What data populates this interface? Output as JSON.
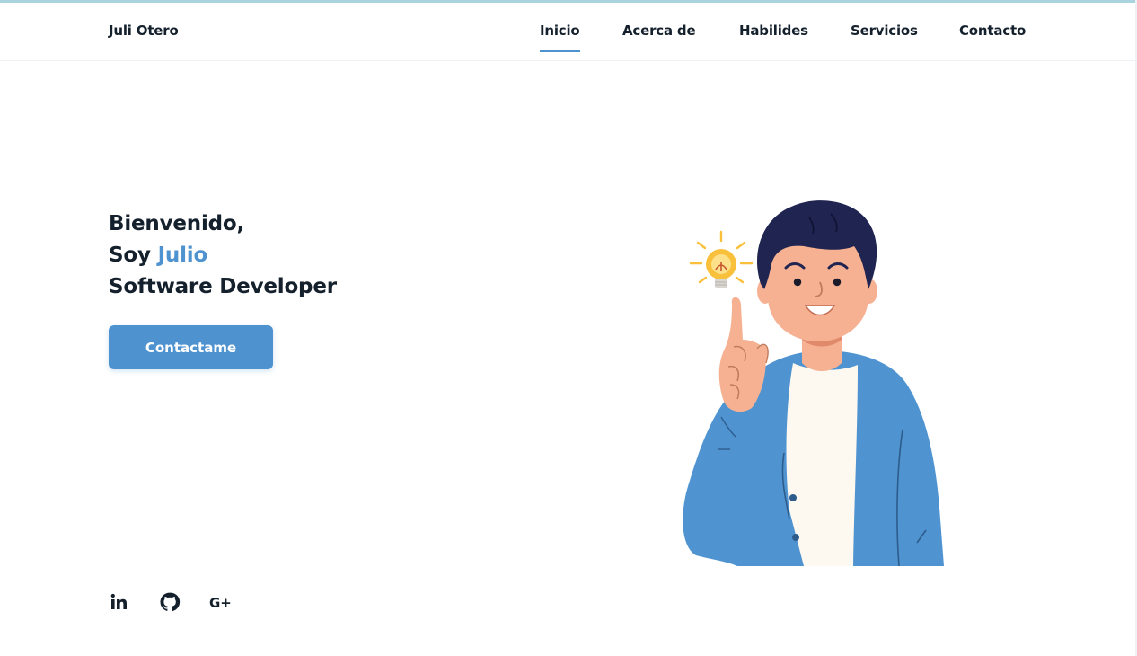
{
  "header": {
    "logo": "Juli Otero",
    "nav": [
      {
        "label": "Inicio",
        "active": true
      },
      {
        "label": "Acerca de",
        "active": false
      },
      {
        "label": "Habilides",
        "active": false
      },
      {
        "label": "Servicios",
        "active": false
      },
      {
        "label": "Contacto",
        "active": false
      }
    ]
  },
  "hero": {
    "greeting": "Bienvenido,",
    "soy": "Soy",
    "name": "Julio",
    "role": "Software Developer",
    "cta_label": "Contactame"
  },
  "social": [
    {
      "icon": "linkedin-icon",
      "text": "in"
    },
    {
      "icon": "github-icon"
    },
    {
      "icon": "google-plus-icon",
      "text": "G+"
    }
  ],
  "colors": {
    "accent": "#4e93cf",
    "text": "#14202c",
    "background": "#ffffff",
    "jacket": "#4f94d1",
    "hair": "#1f2450",
    "skin": "#f5b192",
    "bulb": "#f8c03b"
  }
}
